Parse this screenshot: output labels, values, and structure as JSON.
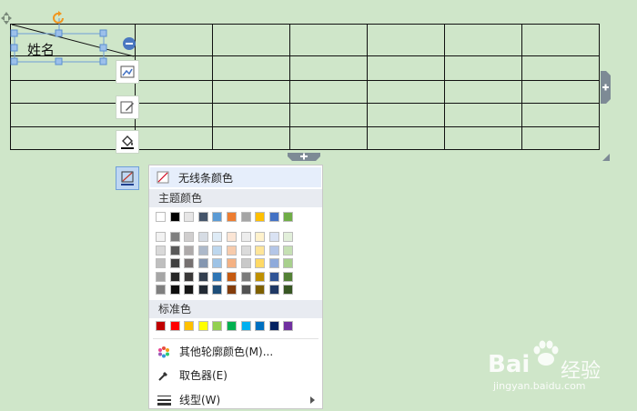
{
  "table": {
    "header_cell_text": "姓名"
  },
  "menu": {
    "no_line_color_label": "无线条颜色",
    "theme_colors_label": "主题颜色",
    "standard_colors_label": "标准色",
    "more_colors_label": "其他轮廓颜色(M)...",
    "eyedropper_label": "取色器(E)",
    "line_style_label": "线型(W)",
    "theme_row": [
      "#ffffff",
      "#000000",
      "#e7e6e6",
      "#44546a",
      "#5b9bd5",
      "#ed7d31",
      "#a5a5a5",
      "#ffc000",
      "#4472c4",
      "#70ad47"
    ],
    "shade_rows": [
      [
        "#f2f2f2",
        "#7f7f7f",
        "#d0cece",
        "#d6dce4",
        "#deebf6",
        "#fbe5d5",
        "#ededed",
        "#fff2cc",
        "#d9e2f3",
        "#e2efda"
      ],
      [
        "#d9d9d9",
        "#595959",
        "#aeaaaa",
        "#adb9ca",
        "#bdd7ee",
        "#f7cbac",
        "#dbdbdb",
        "#fee599",
        "#b4c6e7",
        "#c6e0b4"
      ],
      [
        "#bfbfbf",
        "#404040",
        "#757070",
        "#8496b0",
        "#9dc3e6",
        "#f4b183",
        "#c9c9c9",
        "#ffd965",
        "#8eaadb",
        "#a8d08d"
      ],
      [
        "#a6a6a6",
        "#262626",
        "#3a3838",
        "#333f4f",
        "#2e75b5",
        "#c55a11",
        "#7b7b7b",
        "#bf9000",
        "#2f5496",
        "#538135"
      ],
      [
        "#7f7f7f",
        "#0d0d0d",
        "#161616",
        "#222a35",
        "#1e4e79",
        "#833c0b",
        "#525252",
        "#7f6000",
        "#1f3864",
        "#375623"
      ]
    ],
    "standard_row": [
      "#c00000",
      "#ff0000",
      "#ffc000",
      "#ffff00",
      "#92d050",
      "#00b050",
      "#00b0f0",
      "#0070c0",
      "#002060",
      "#7030a0"
    ]
  },
  "watermark": {
    "brand": "Bai",
    "brand2": "经验",
    "url": "jingyan.baidu.com"
  }
}
